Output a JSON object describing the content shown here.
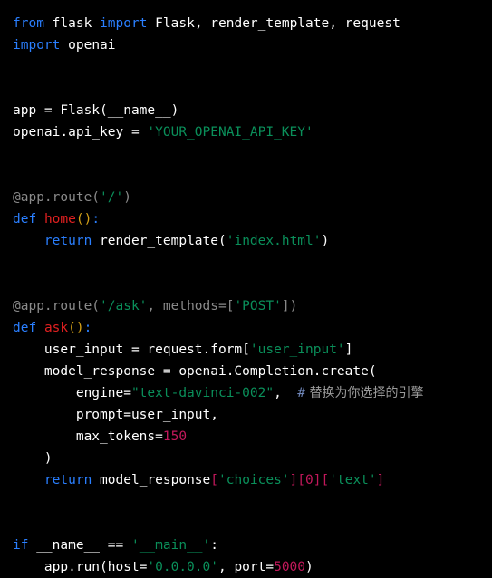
{
  "editor": {
    "language": "python",
    "background_color": "#000000",
    "default_text_color": "#e8e8e8",
    "line_height_px": 24,
    "font_size_px": 14.5,
    "theme_colors": {
      "keyword": "#2a7fff",
      "function_name": "#e02020",
      "string": "#0a8f5a",
      "number": "#c2185b",
      "identifier": "#ffffff",
      "decorator": "#8a8a8a",
      "bracket_accent": "#c2185b",
      "paren_accent": "#d4a017",
      "comment": "#9a9a9a",
      "comment_hash": "#6f86b8"
    }
  },
  "code": {
    "lines": [
      {
        "n": 1,
        "text": "from flask import Flask, render_template, request",
        "tokens": [
          {
            "t": "from",
            "c": "kw"
          },
          {
            "t": " ",
            "c": "plain"
          },
          {
            "t": "flask",
            "c": "plain"
          },
          {
            "t": " ",
            "c": "plain"
          },
          {
            "t": "import",
            "c": "kw"
          },
          {
            "t": " ",
            "c": "plain"
          },
          {
            "t": "Flask, render_template, request",
            "c": "plain"
          }
        ]
      },
      {
        "n": 2,
        "text": "import openai",
        "tokens": [
          {
            "t": "import",
            "c": "kw"
          },
          {
            "t": " ",
            "c": "plain"
          },
          {
            "t": "openai",
            "c": "plain"
          }
        ]
      },
      {
        "n": 3,
        "text": "",
        "tokens": []
      },
      {
        "n": 4,
        "text": "",
        "tokens": []
      },
      {
        "n": 5,
        "text": "app = Flask(__name__)",
        "tokens": [
          {
            "t": "app = Flask(__name__)",
            "c": "plain"
          }
        ]
      },
      {
        "n": 6,
        "text": "openai.api_key = 'YOUR_OPENAI_API_KEY'",
        "tokens": [
          {
            "t": "openai.api_key = ",
            "c": "plain"
          },
          {
            "t": "'YOUR_OPENAI_API_KEY'",
            "c": "str"
          }
        ]
      },
      {
        "n": 7,
        "text": "",
        "tokens": []
      },
      {
        "n": 8,
        "text": "",
        "tokens": []
      },
      {
        "n": 9,
        "text": "@app.route('/')",
        "tokens": [
          {
            "t": "@app.route(",
            "c": "deco"
          },
          {
            "t": "'/'",
            "c": "str"
          },
          {
            "t": ")",
            "c": "deco"
          }
        ]
      },
      {
        "n": 10,
        "text": "def home():",
        "tokens": [
          {
            "t": "def",
            "c": "kw"
          },
          {
            "t": " ",
            "c": "plain"
          },
          {
            "t": "home",
            "c": "fn"
          },
          {
            "t": "()",
            "c": "punc"
          },
          {
            "t": ":",
            "c": "colon"
          }
        ]
      },
      {
        "n": 11,
        "text": "    return render_template('index.html')",
        "tokens": [
          {
            "t": "    ",
            "c": "plain"
          },
          {
            "t": "return",
            "c": "kw"
          },
          {
            "t": " ",
            "c": "plain"
          },
          {
            "t": "render_template(",
            "c": "plain"
          },
          {
            "t": "'index.html'",
            "c": "str"
          },
          {
            "t": ")",
            "c": "plain"
          }
        ]
      },
      {
        "n": 12,
        "text": "",
        "tokens": []
      },
      {
        "n": 13,
        "text": "",
        "tokens": []
      },
      {
        "n": 14,
        "text": "@app.route('/ask', methods=['POST'])",
        "tokens": [
          {
            "t": "@app.route(",
            "c": "deco"
          },
          {
            "t": "'/ask'",
            "c": "str"
          },
          {
            "t": ", methods=[",
            "c": "deco"
          },
          {
            "t": "'POST'",
            "c": "str"
          },
          {
            "t": "])",
            "c": "deco"
          }
        ]
      },
      {
        "n": 15,
        "text": "def ask():",
        "tokens": [
          {
            "t": "def",
            "c": "kw"
          },
          {
            "t": " ",
            "c": "plain"
          },
          {
            "t": "ask",
            "c": "fn"
          },
          {
            "t": "()",
            "c": "punc"
          },
          {
            "t": ":",
            "c": "colon"
          }
        ]
      },
      {
        "n": 16,
        "text": "    user_input = request.form['user_input']",
        "tokens": [
          {
            "t": "    user_input = request.form[",
            "c": "plain"
          },
          {
            "t": "'user_input'",
            "c": "str"
          },
          {
            "t": "]",
            "c": "plain"
          }
        ]
      },
      {
        "n": 17,
        "text": "    model_response = openai.Completion.create(",
        "tokens": [
          {
            "t": "    model_response = openai.Completion.create(",
            "c": "plain"
          }
        ]
      },
      {
        "n": 18,
        "text": "        engine=\"text-davinci-002\",  # 替换为你选择的引擎",
        "tokens": [
          {
            "t": "        engine=",
            "c": "plain"
          },
          {
            "t": "\"text-davinci-002\"",
            "c": "str"
          },
          {
            "t": ",  ",
            "c": "plain"
          },
          {
            "t": "#",
            "c": "hash"
          },
          {
            "t": " 替换为你选择的引擎",
            "c": "cmt cjk"
          }
        ]
      },
      {
        "n": 19,
        "text": "        prompt=user_input,",
        "tokens": [
          {
            "t": "        prompt=user_input,",
            "c": "plain"
          }
        ]
      },
      {
        "n": 20,
        "text": "        max_tokens=150",
        "tokens": [
          {
            "t": "        max_tokens=",
            "c": "plain"
          },
          {
            "t": "150",
            "c": "num"
          }
        ]
      },
      {
        "n": 21,
        "text": "    )",
        "tokens": [
          {
            "t": "    )",
            "c": "plain"
          }
        ]
      },
      {
        "n": 22,
        "text": "    return model_response['choices'][0]['text']",
        "tokens": [
          {
            "t": "    ",
            "c": "plain"
          },
          {
            "t": "return",
            "c": "kw"
          },
          {
            "t": " ",
            "c": "plain"
          },
          {
            "t": "model_response",
            "c": "plain"
          },
          {
            "t": "[",
            "c": "br"
          },
          {
            "t": "'choices'",
            "c": "str"
          },
          {
            "t": "][",
            "c": "br"
          },
          {
            "t": "0",
            "c": "num"
          },
          {
            "t": "][",
            "c": "br"
          },
          {
            "t": "'text'",
            "c": "str"
          },
          {
            "t": "]",
            "c": "br"
          }
        ]
      },
      {
        "n": 23,
        "text": "",
        "tokens": []
      },
      {
        "n": 24,
        "text": "",
        "tokens": []
      },
      {
        "n": 25,
        "text": "if __name__ == '__main__':",
        "tokens": [
          {
            "t": "if",
            "c": "kw"
          },
          {
            "t": " __name__ == ",
            "c": "plain"
          },
          {
            "t": "'__main__'",
            "c": "str"
          },
          {
            "t": ":",
            "c": "plain"
          }
        ]
      },
      {
        "n": 26,
        "text": "    app.run(host='0.0.0.0', port=5000)",
        "tokens": [
          {
            "t": "    app.run(host=",
            "c": "plain"
          },
          {
            "t": "'0.0.0.0'",
            "c": "str"
          },
          {
            "t": ", port=",
            "c": "plain"
          },
          {
            "t": "5000",
            "c": "num"
          },
          {
            "t": ")",
            "c": "plain"
          }
        ]
      }
    ]
  }
}
